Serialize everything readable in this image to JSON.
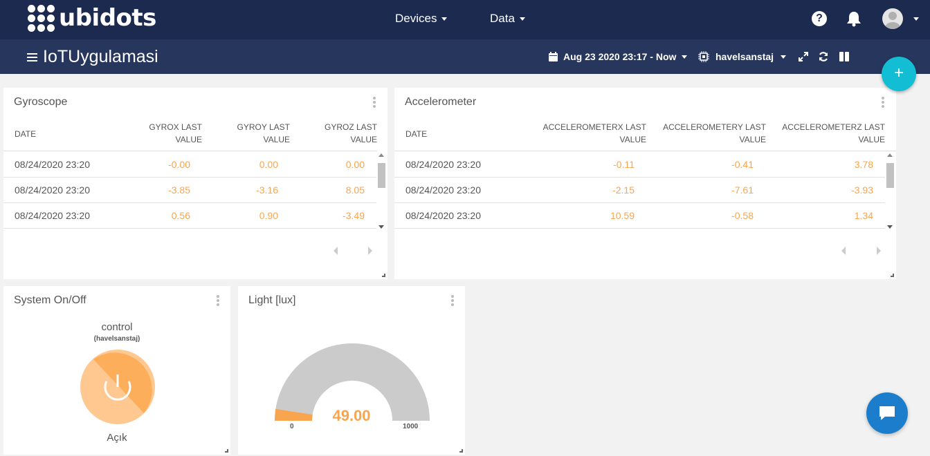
{
  "brand": {
    "logo_text": "ubidots"
  },
  "nav": {
    "devices": "Devices",
    "data": "Data",
    "help_icon": "?"
  },
  "header": {
    "dashboard_title": "IoTUygulamasi",
    "date_range": "Aug 23 2020 23:17 - Now",
    "device": "havelsanstaj"
  },
  "fab": {
    "add": "+"
  },
  "gyroscope": {
    "title": "Gyroscope",
    "columns": {
      "date": "DATE",
      "x1": "GYROX LAST",
      "x2": "VALUE",
      "y1": "GYROY LAST",
      "y2": "VALUE",
      "z1": "GYROZ LAST",
      "z2": "VALUE"
    },
    "rows": [
      {
        "date": "08/24/2020 23:20",
        "x": "-0.00",
        "y": "0.00",
        "z": "0.00"
      },
      {
        "date": "08/24/2020 23:20",
        "x": "-3.85",
        "y": "-3.16",
        "z": "8.05"
      },
      {
        "date": "08/24/2020 23:20",
        "x": "0.56",
        "y": "0.90",
        "z": "-3.49"
      }
    ]
  },
  "accelerometer": {
    "title": "Accelerometer",
    "columns": {
      "date": "DATE",
      "x1": "ACCELEROMETERX LAST",
      "x2": "VALUE",
      "y1": "ACCELEROMETERY LAST",
      "y2": "VALUE",
      "z1": "ACCELEROMETERZ LAST",
      "z2": "VALUE"
    },
    "rows": [
      {
        "date": "08/24/2020 23:20",
        "x": "-0.11",
        "y": "-0.41",
        "z": "3.78"
      },
      {
        "date": "08/24/2020 23:20",
        "x": "-2.15",
        "y": "-7.61",
        "z": "-3.93"
      },
      {
        "date": "08/24/2020 23:20",
        "x": "10.59",
        "y": "-0.58",
        "z": "1.34"
      }
    ]
  },
  "switch": {
    "title": "System On/Off",
    "variable": "control",
    "device": "(havelsanstaj)",
    "state": "Açık"
  },
  "gauge": {
    "title": "Light [lux]",
    "value": "49.00",
    "min": "0",
    "max": "1000",
    "level": 0.049
  },
  "colors": {
    "navbar": "#1b2a4e",
    "subbar": "#27365c",
    "accent": "#f9a550",
    "fab": "#13bdd3",
    "chat": "#1c7dcc"
  }
}
